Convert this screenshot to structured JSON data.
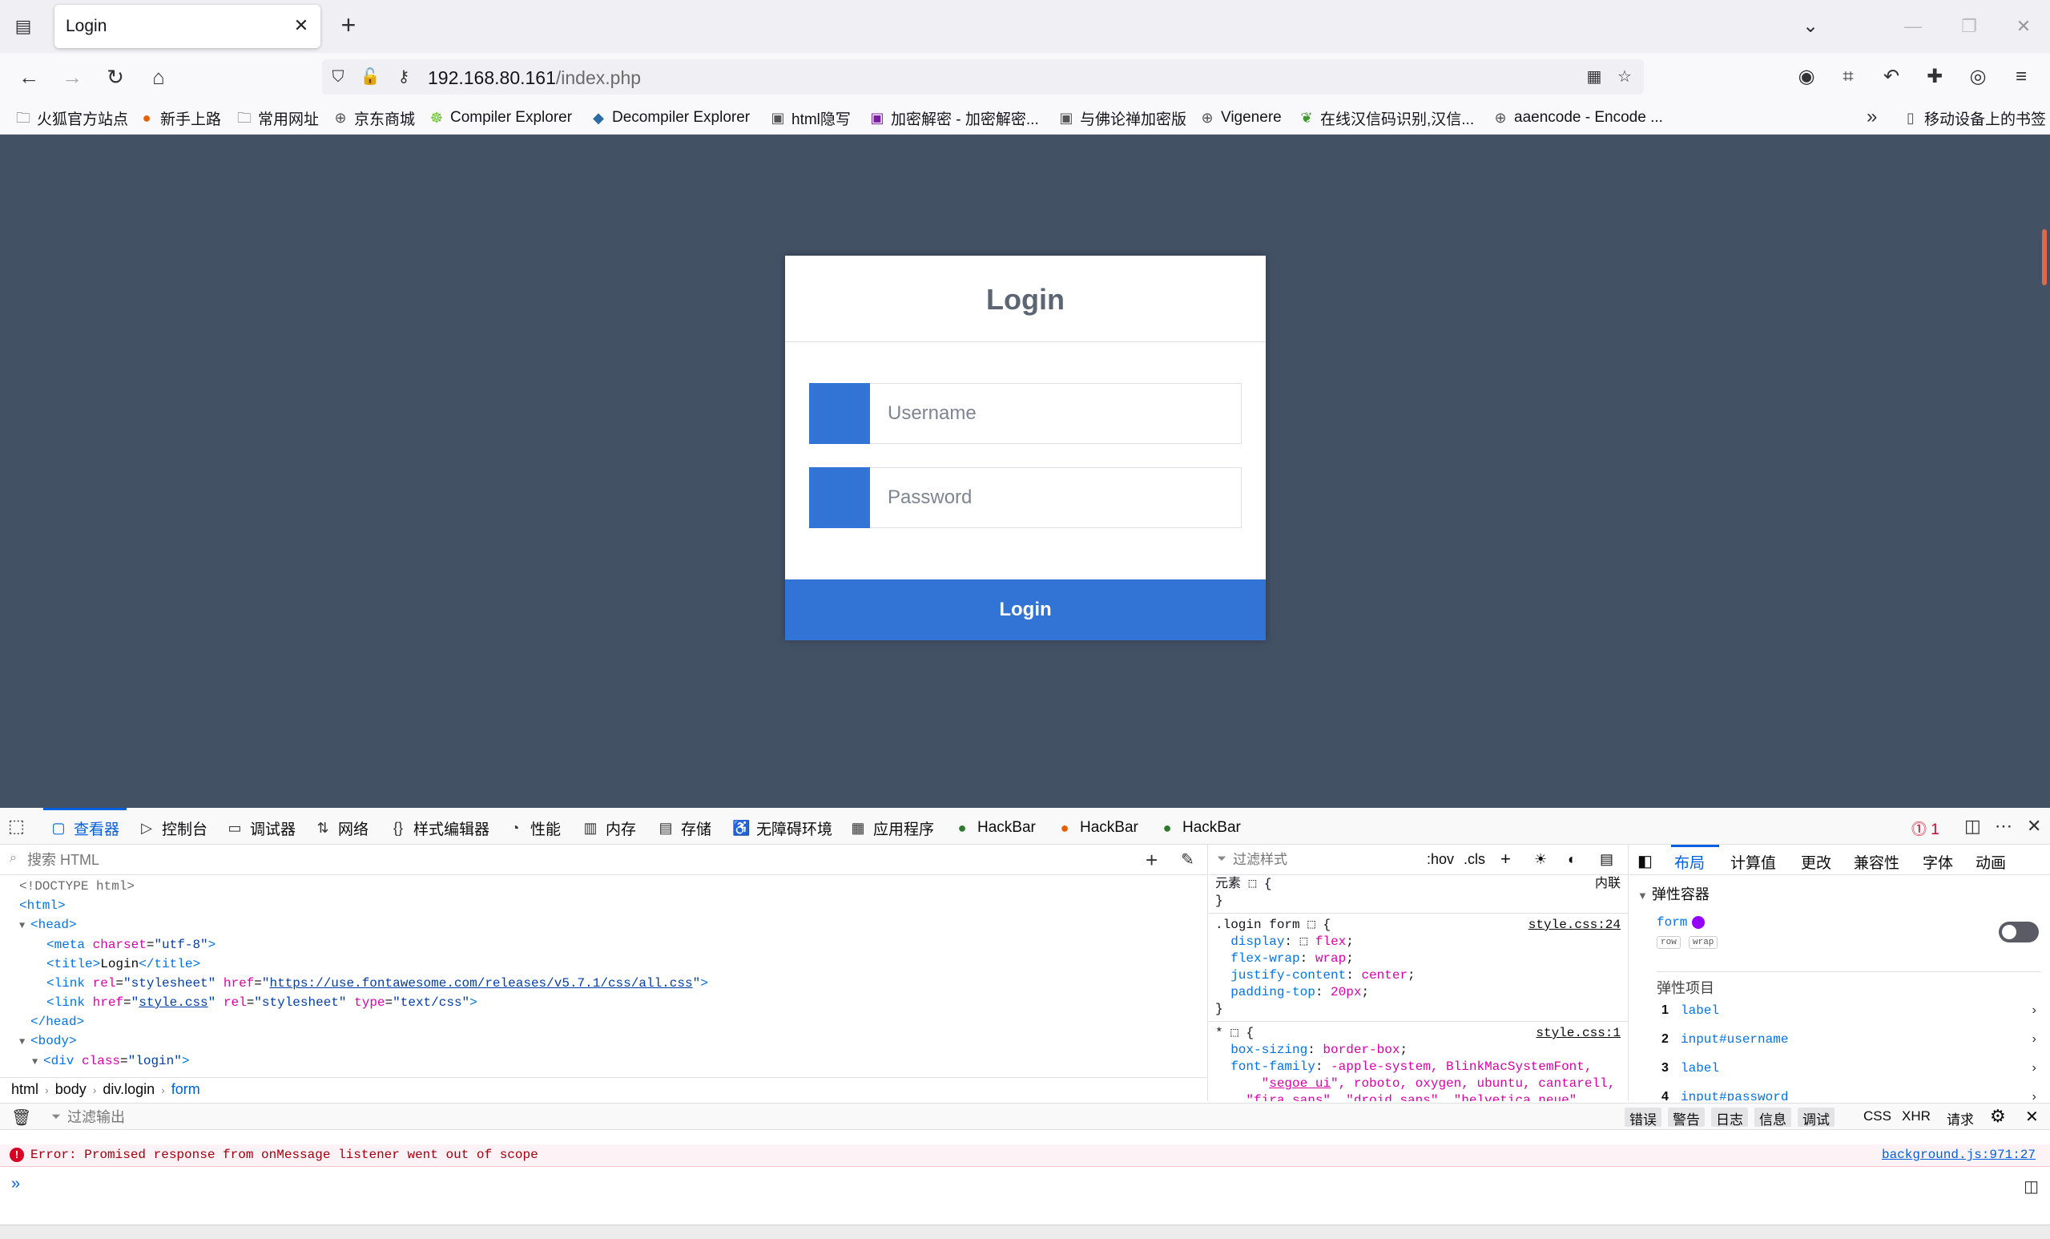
{
  "browser": {
    "tab": {
      "title": "Login"
    },
    "url": {
      "host": "192.168.80.161",
      "path": "/index.php"
    },
    "bookmarks": [
      {
        "label": "火狐官方站点",
        "icon": "folder-icon"
      },
      {
        "label": "新手上路",
        "icon": "firefox-icon"
      },
      {
        "label": "常用网址",
        "icon": "folder-icon"
      },
      {
        "label": "京东商城",
        "icon": "globe-icon"
      },
      {
        "label": "Compiler Explorer",
        "icon": "compiler-icon"
      },
      {
        "label": "Decompiler Explorer",
        "icon": "gem-icon"
      },
      {
        "label": "html隐写",
        "icon": "image-icon"
      },
      {
        "label": "加密解密 - 加密解密...",
        "icon": "lock-site-icon"
      },
      {
        "label": "与佛论禅加密版",
        "icon": "image-icon"
      },
      {
        "label": "Vigenere",
        "icon": "globe-icon"
      },
      {
        "label": "在线汉信码识别,汉信...",
        "icon": "leaf-icon"
      },
      {
        "label": "aaencode - Encode ...",
        "icon": "globe-icon"
      }
    ],
    "mobile_bookmarks": "移动设备上的书签"
  },
  "page": {
    "title": "Login",
    "username_placeholder": "Username",
    "password_placeholder": "Password",
    "submit_label": "Login"
  },
  "devtools": {
    "tabs": [
      "查看器",
      "控制台",
      "调试器",
      "网络",
      "样式编辑器",
      "性能",
      "内存",
      "存储",
      "无障碍环境",
      "应用程序",
      "HackBar",
      "HackBar",
      "HackBar"
    ],
    "error_count": "1",
    "inspector": {
      "search_placeholder": "搜索 HTML",
      "breadcrumb": [
        "html",
        "body",
        "div.login",
        "form"
      ]
    },
    "rules": {
      "filter_placeholder": "过滤样式",
      "hov": ":hov",
      "cls": ".cls",
      "element_label": "元素",
      "inline_label": "内联",
      "rule1_selector": ".login form",
      "rule1_source": "style.css:24",
      "rule2_selector": "*",
      "rule2_source": "style.css:1"
    },
    "layout": {
      "tabs": [
        "布局",
        "计算值",
        "更改",
        "兼容性",
        "字体",
        "动画"
      ],
      "flex_container": "弹性容器",
      "container_name": "form",
      "chips": [
        "row",
        "wrap"
      ],
      "flex_items_header": "弹性项目",
      "items": [
        {
          "num": "1",
          "name": "label"
        },
        {
          "num": "2",
          "name": "input#username"
        },
        {
          "num": "3",
          "name": "label"
        },
        {
          "num": "4",
          "name": "input#password"
        }
      ]
    },
    "console": {
      "filter_placeholder": "过滤输出",
      "levels": [
        "错误",
        "警告",
        "日志",
        "信息",
        "调试"
      ],
      "options": [
        "CSS",
        "XHR",
        "请求"
      ],
      "error_message": "Error: Promised response from onMessage listener went out of scope",
      "error_source": "background.js:971:27"
    }
  }
}
